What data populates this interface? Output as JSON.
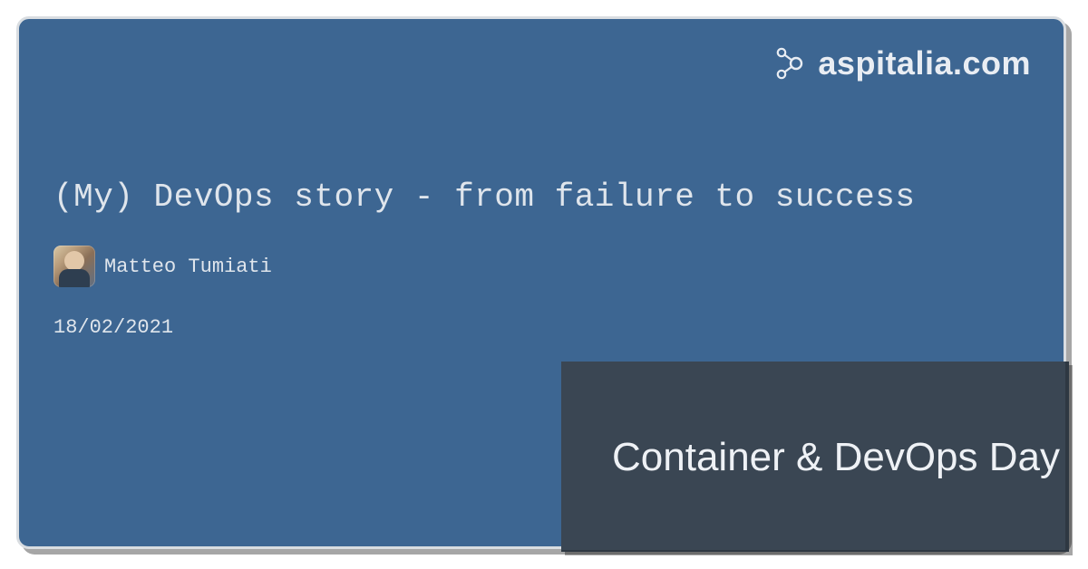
{
  "brand": {
    "name": "aspitalia.com"
  },
  "talk": {
    "title": "(My) DevOps story - from failure to success",
    "author": "Matteo Tumiati",
    "date": "18/02/2021"
  },
  "event": {
    "name": "Container & DevOps Day"
  }
}
